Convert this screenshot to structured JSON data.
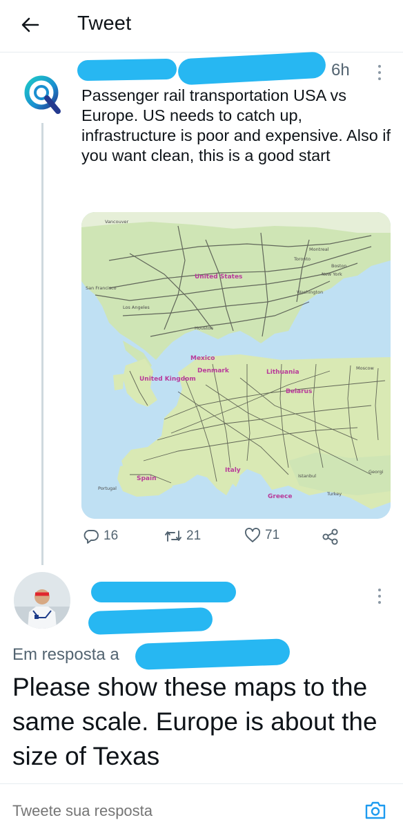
{
  "header": {
    "title": "Tweet",
    "back_icon": "arrow-left-icon"
  },
  "tweet": {
    "time": "6h",
    "text": "Passenger rail transportation USA vs Europe. US needs to catch up, infrastructure is poor and expensive. Also if you want clean, this is a good start",
    "avatar_icon": "q-logo-icon",
    "map_labels": {
      "vancouver": "Vancouver",
      "montreal": "Montreal",
      "toronto": "Toronto",
      "boston": "Boston",
      "new_york": "New York",
      "washington": "Washington",
      "san_francisco": "San Francisco",
      "los_angeles": "Los Angeles",
      "united_states": "United States",
      "houston": "Houston",
      "mexico": "Mexico",
      "denmark": "Denmark",
      "lithuania": "Lithuania",
      "moscow": "Moscow",
      "united_kingdom": "United Kingdom",
      "belarus": "Belarus",
      "spain": "Spain",
      "portugal": "Portugal",
      "italy": "Italy",
      "istanbul": "Istanbul",
      "greece": "Greece",
      "turkey": "Turkey",
      "georgia": "Georgi"
    },
    "stats": {
      "replies": "16",
      "retweets": "21",
      "likes": "71"
    },
    "icons": {
      "reply": "reply-icon",
      "retweet": "retweet-icon",
      "like": "heart-icon",
      "share": "share-icon"
    }
  },
  "reply": {
    "reply_to_label": "Em resposta a",
    "text": "Please show these maps to the same scale. Europe is about the size of Texas"
  },
  "composer": {
    "placeholder": "Tweete sua resposta",
    "camera_icon": "camera-icon"
  },
  "colors": {
    "accent": "#1d9bf0",
    "redaction": "#27b7f2",
    "muted_text": "#536471",
    "divider": "#e6ecf0"
  }
}
